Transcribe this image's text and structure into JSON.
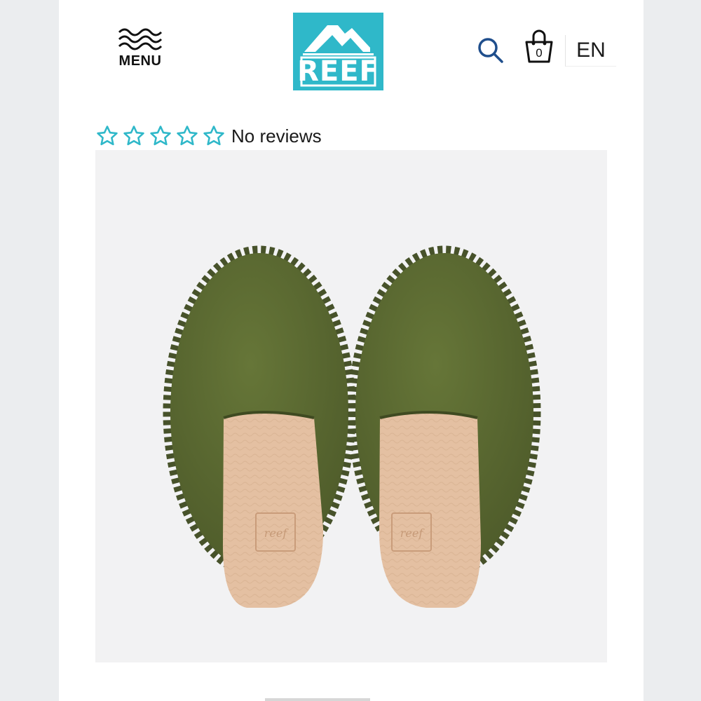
{
  "header": {
    "menu_label": "MENU",
    "brand": "REEF",
    "brand_color": "#2fb8c9",
    "search_icon": "search-icon",
    "cart_count": "0",
    "language": "EN",
    "icon_color": "#1f4e8c"
  },
  "product": {
    "rating_stars": 5,
    "rating_value": 0,
    "reviews_text": "No reviews",
    "star_color": "#2fb8c9",
    "image": {
      "subject": "olive suede slip-on mules with tan footbeds",
      "upper_color": "#5b6b32",
      "footbed_color": "#e4c0a2"
    }
  }
}
